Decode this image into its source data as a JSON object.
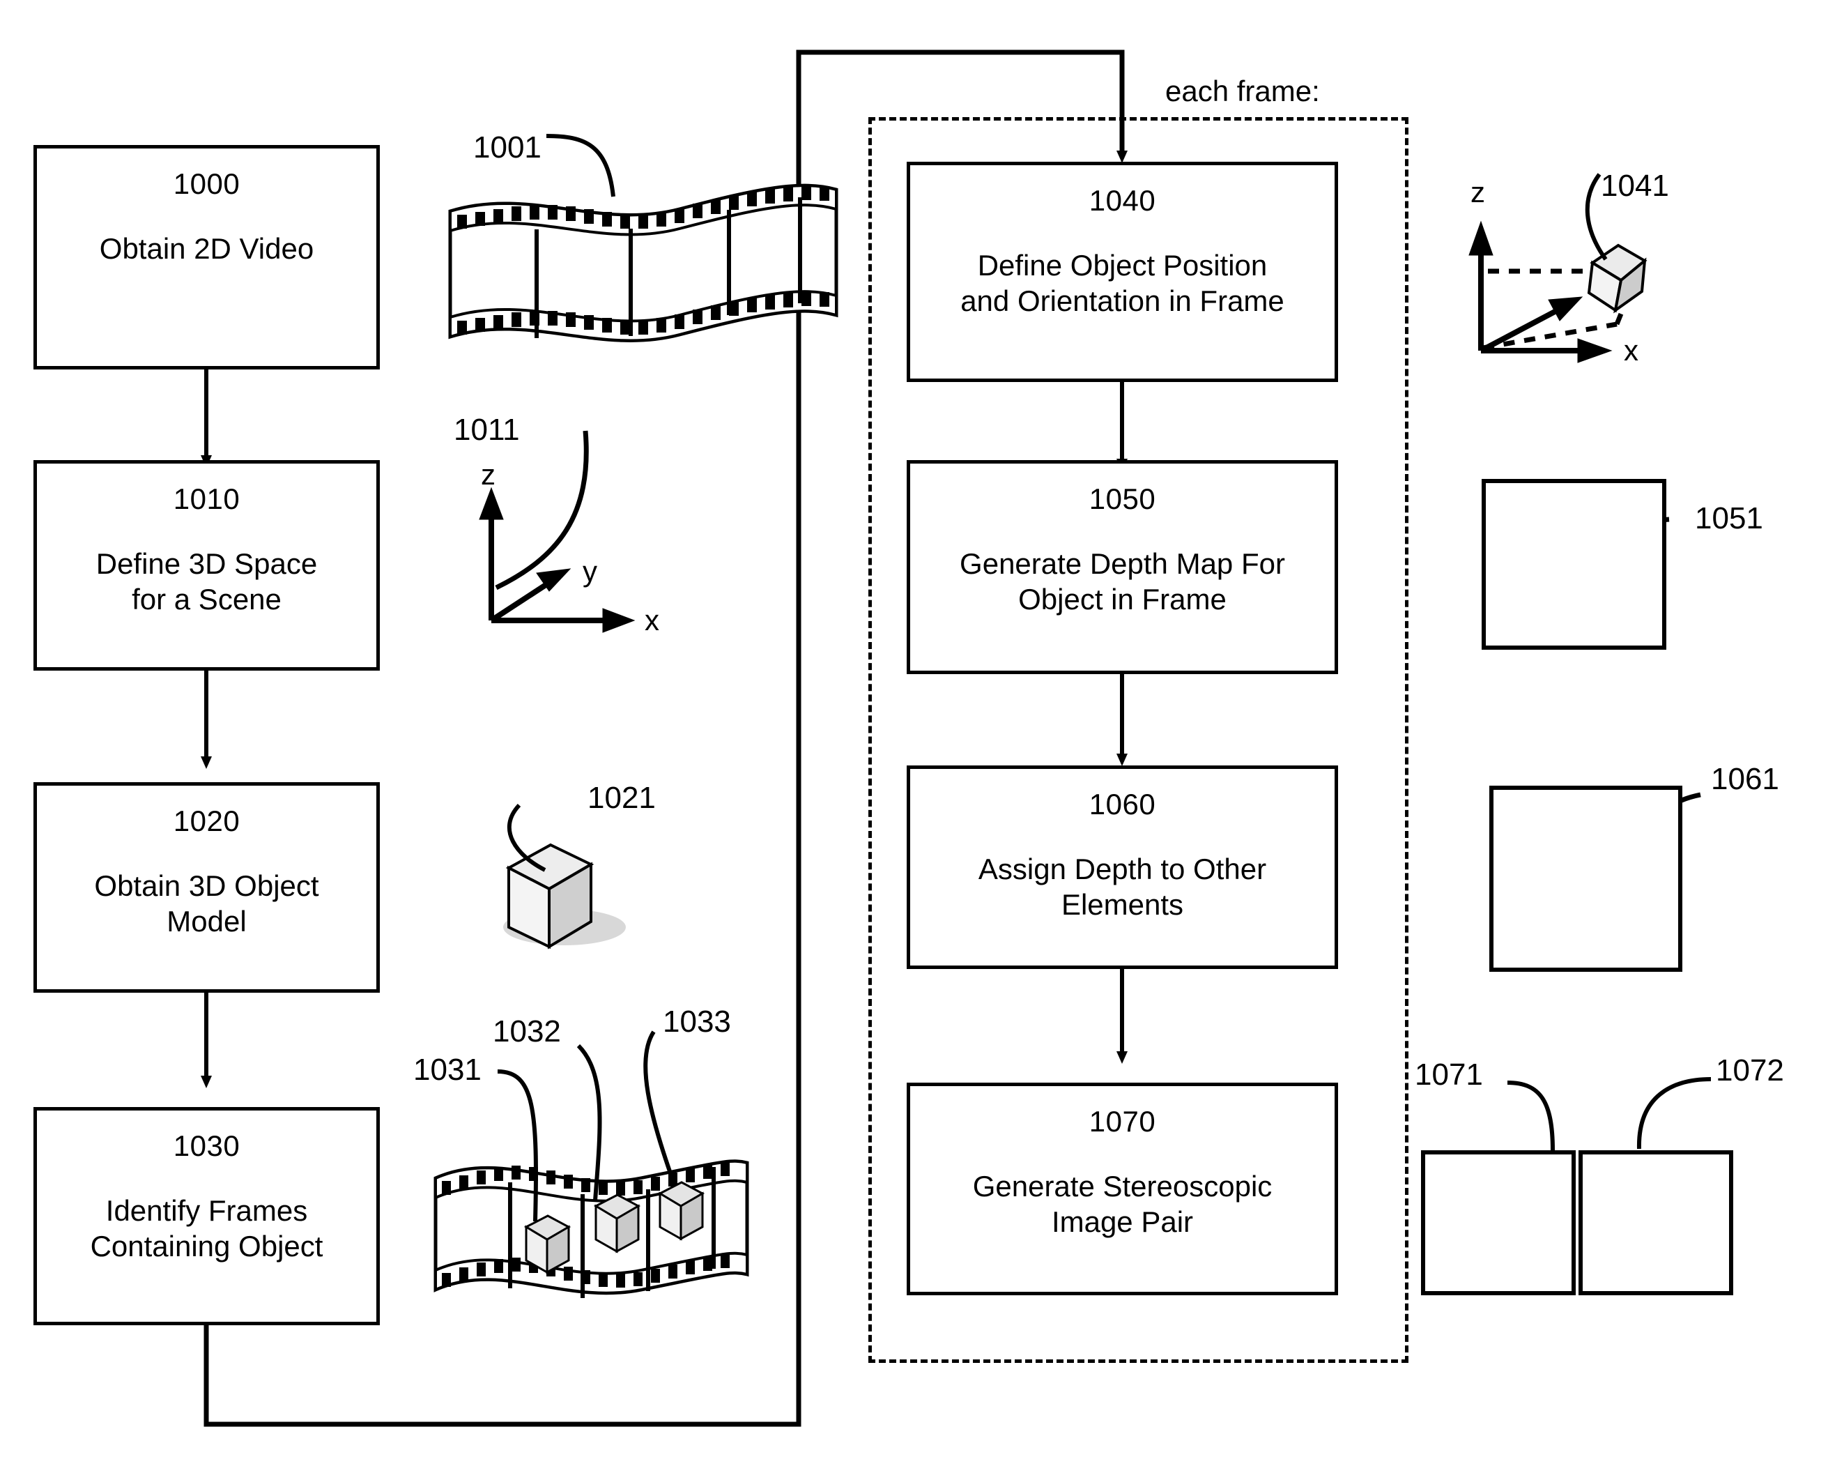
{
  "figure": {
    "type": "patent-flowchart",
    "loop_label": "each frame:"
  },
  "left_column": {
    "steps": [
      {
        "num": "1000",
        "label": "Obtain 2D Video"
      },
      {
        "num": "1010",
        "label": "Define 3D Space\nfor a Scene"
      },
      {
        "num": "1020",
        "label": "Obtain 3D Object\nModel"
      },
      {
        "num": "1030",
        "label": "Identify Frames\nContaining Object"
      }
    ]
  },
  "right_column": {
    "steps": [
      {
        "num": "1040",
        "label": "Define Object Position\nand Orientation in Frame"
      },
      {
        "num": "1050",
        "label": "Generate Depth Map For\nObject in Frame"
      },
      {
        "num": "1060",
        "label": "Assign Depth to Other\nElements"
      },
      {
        "num": "1070",
        "label": "Generate Stereoscopic\nImage Pair"
      }
    ]
  },
  "illustrations": {
    "filmstrip_plain": {
      "ref": "1001"
    },
    "axes_xyz": {
      "ref": "1011",
      "axis_x": "x",
      "axis_y": "y",
      "axis_z": "z"
    },
    "cube_model": {
      "ref": "1021"
    },
    "filmstrip_frames": {
      "refs": [
        "1031",
        "1032",
        "1033"
      ]
    },
    "axes_object_pose": {
      "ref": "1041",
      "axis_x": "x",
      "axis_z": "z"
    },
    "depth_map_object": {
      "ref": "1051"
    },
    "depth_map_scene": {
      "ref": "1061"
    },
    "stereo_pair": {
      "left_ref": "1071",
      "right_ref": "1072"
    }
  },
  "colors": {
    "ink": "#000000",
    "paper": "#ffffff",
    "fill_light": "#e8e8e8",
    "fill_mid": "#c9c9c9",
    "fill_dark": "#9a9a9a"
  }
}
